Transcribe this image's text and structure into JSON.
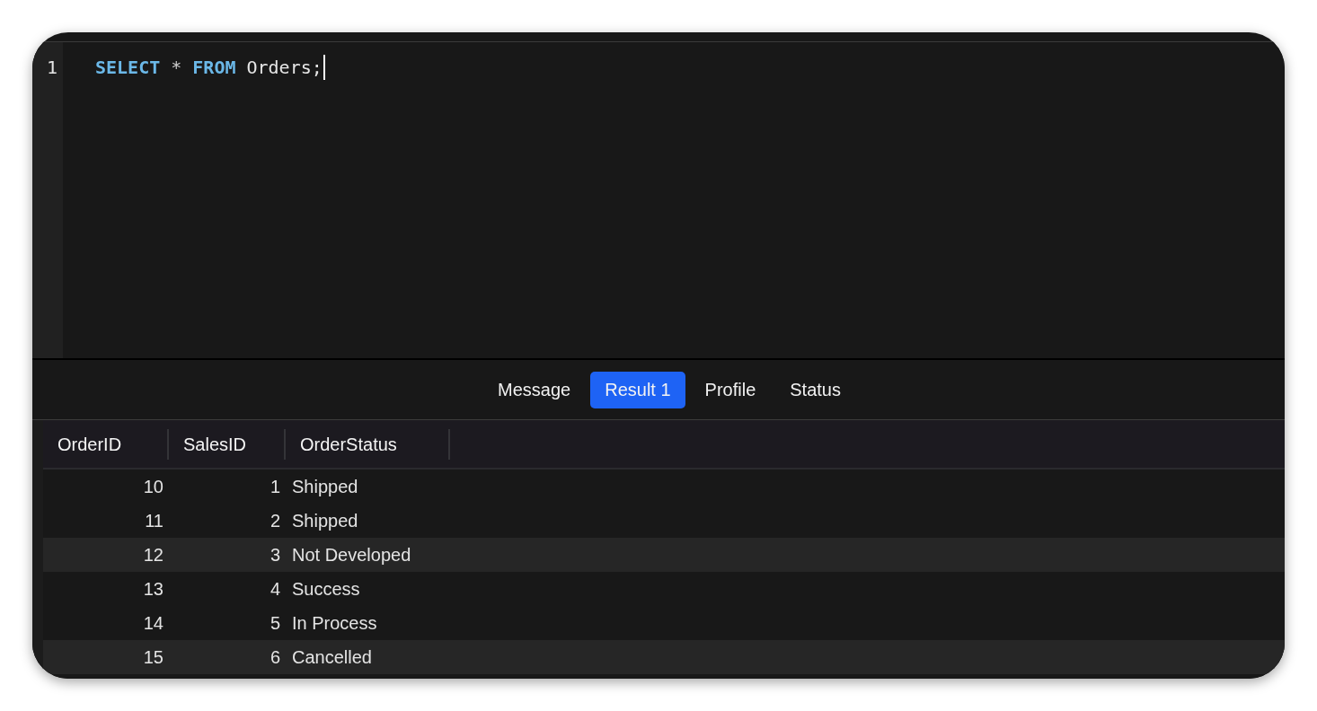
{
  "editor": {
    "lines": [
      {
        "number": "1",
        "tokens": [
          {
            "kind": "keyword",
            "text": "SELECT"
          },
          {
            "kind": "operator",
            "text": "*"
          },
          {
            "kind": "keyword",
            "text": "FROM"
          },
          {
            "kind": "identifier",
            "text": "Orders;"
          }
        ]
      }
    ]
  },
  "tabs": [
    {
      "label": "Message",
      "selected": false
    },
    {
      "label": "Result 1",
      "selected": true
    },
    {
      "label": "Profile",
      "selected": false
    },
    {
      "label": "Status",
      "selected": false
    }
  ],
  "table": {
    "columns": [
      {
        "label": "OrderID"
      },
      {
        "label": "SalesID"
      },
      {
        "label": "OrderStatus"
      }
    ],
    "rows": [
      {
        "cells": [
          "10",
          "1",
          "Shipped"
        ],
        "shaded": false
      },
      {
        "cells": [
          "11",
          "2",
          "Shipped"
        ],
        "shaded": false
      },
      {
        "cells": [
          "12",
          "3",
          "Not Developed"
        ],
        "shaded": true
      },
      {
        "cells": [
          "13",
          "4",
          "Success"
        ],
        "shaded": false
      },
      {
        "cells": [
          "14",
          "5",
          "In Process"
        ],
        "shaded": false
      },
      {
        "cells": [
          "15",
          "6",
          "Cancelled"
        ],
        "shaded": true
      }
    ]
  }
}
